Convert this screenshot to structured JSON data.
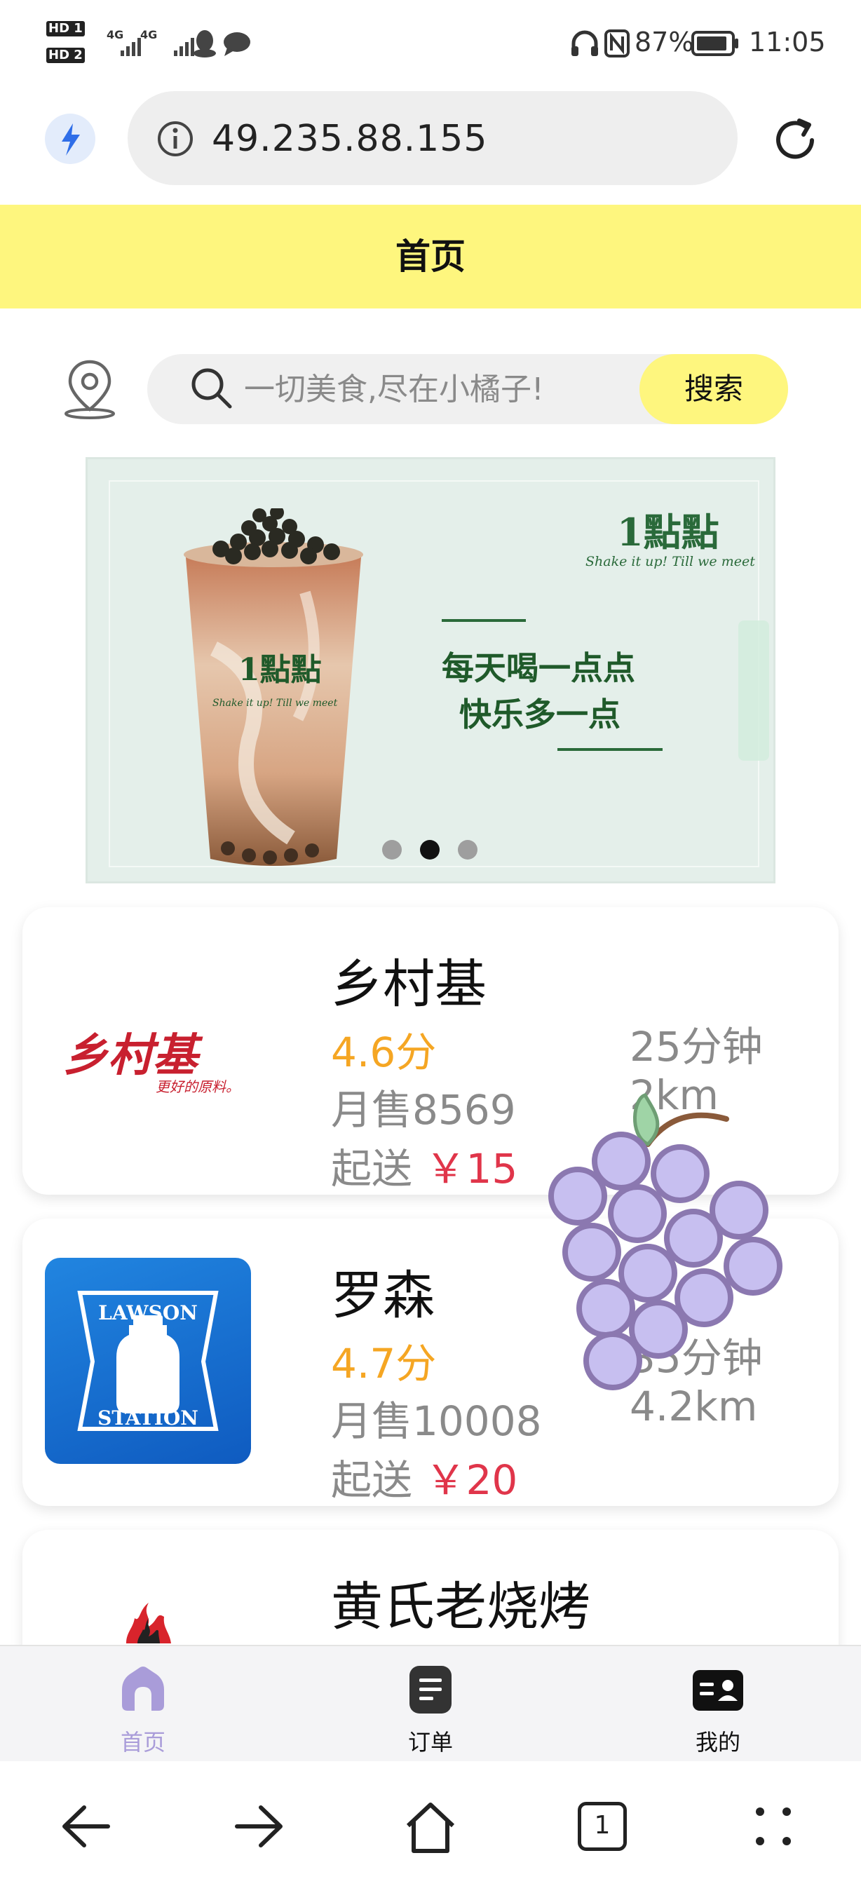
{
  "status_bar": {
    "hd1": "HD 1",
    "hd2": "HD 2",
    "signal1": "4G",
    "signal2": "4G",
    "battery": "87%",
    "time": "11:05"
  },
  "browser": {
    "url": "49.235.88.155"
  },
  "header": {
    "title": "首页"
  },
  "search": {
    "placeholder": "一切美食,尽在小橘子!",
    "button_label": "搜索"
  },
  "banner": {
    "brand_logo": "1點點",
    "brand_slogan": "Shake it up! Till we meet",
    "headline_line1": "每天喝一点点",
    "headline_line2": "快乐多一点",
    "cup_logo": "1點點",
    "cup_slogan": "Shake it up! Till we meet",
    "active_slide": 2,
    "slide_count": 3
  },
  "shops": [
    {
      "name": "乡村基",
      "logo_text": "乡村基",
      "logo_sub": "更好的原料。",
      "rating": "4.6分",
      "sales": "月售8569",
      "min_order_label": "起送",
      "min_order_price": "￥15",
      "eta_time": "25分钟",
      "eta_distance": "2km"
    },
    {
      "name": "罗森",
      "logo_text_top": "LAWSON",
      "logo_text_bottom": "STATION",
      "rating": "4.7分",
      "sales": "月售10008",
      "min_order_label": "起送",
      "min_order_price": "￥20",
      "eta_time": "35分钟",
      "eta_distance": "4.2km"
    },
    {
      "name": "黄氏老烧烤"
    }
  ],
  "tabbar": {
    "items": [
      {
        "label": "首页",
        "icon": "home-icon",
        "active": true
      },
      {
        "label": "订单",
        "icon": "order-icon",
        "active": false
      },
      {
        "label": "我的",
        "icon": "profile-icon",
        "active": false
      }
    ]
  },
  "browser_nav": {
    "tabs_count": "1"
  },
  "colors": {
    "accent_yellow": "#fef67e",
    "rating": "#f5a623",
    "price": "#e0354a",
    "active_tab": "#a99cd9",
    "lawson_blue": "#1665c9",
    "xiangcunji_red": "#c8202f",
    "grape": "#c7bff0"
  }
}
